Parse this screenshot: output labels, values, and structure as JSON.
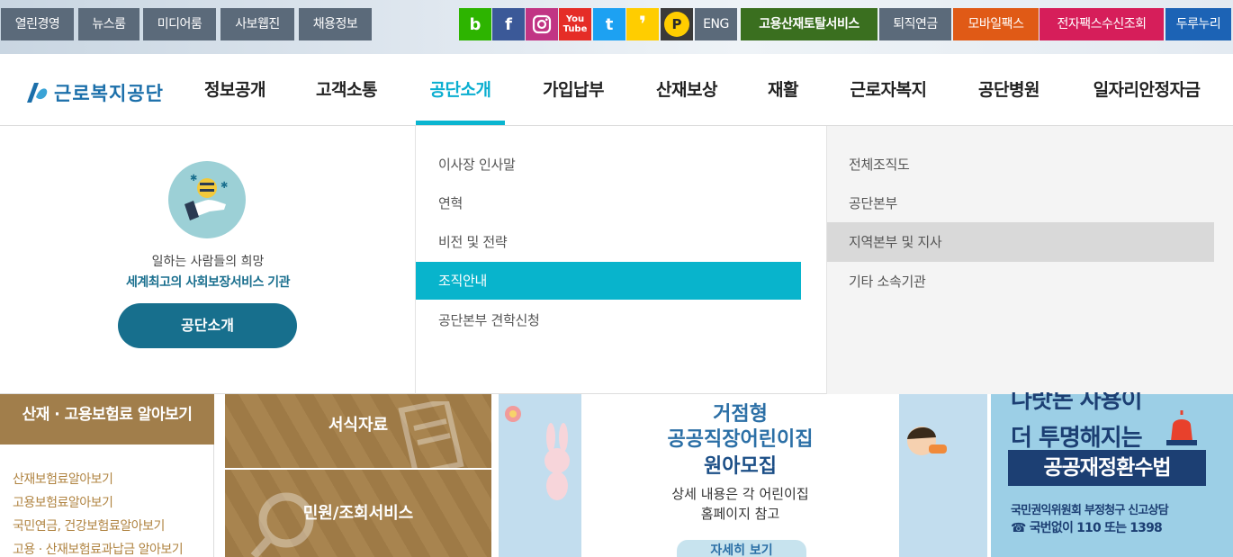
{
  "top_utility": [
    "열린경영",
    "뉴스룸",
    "미디어룸",
    "사보웹진",
    "채용정보"
  ],
  "sns": [
    {
      "icon": "blog-icon",
      "glyph": "b",
      "color": "#2db400"
    },
    {
      "icon": "facebook-icon",
      "glyph": "f",
      "color": "#3b5998"
    },
    {
      "icon": "instagram-icon",
      "glyph": "◎",
      "color": "#c13584"
    },
    {
      "icon": "youtube-icon",
      "glyph": "You",
      "color": "#e52d27"
    },
    {
      "icon": "twitter-icon",
      "glyph": "t",
      "color": "#1da1f2"
    },
    {
      "icon": "kakao-story-icon",
      "glyph": "❟",
      "color": "#ffcd00"
    },
    {
      "icon": "post-icon",
      "glyph": "P",
      "color": "#2a2a2a"
    }
  ],
  "right_links": [
    {
      "label": "ENG",
      "color": "#5b6a7a"
    },
    {
      "label": "고용산재토탈서비스",
      "color": "#3a6f1f"
    },
    {
      "label": "퇴직연금",
      "color": "#5b6a7a"
    },
    {
      "label": "모바일팩스",
      "color": "#e05a16"
    },
    {
      "label": "전자팩스수신조회",
      "color": "#d61e5a"
    },
    {
      "label": "두루누리",
      "color": "#1c63b5"
    }
  ],
  "logo": {
    "text": "근로복지공단"
  },
  "gnb": [
    "정보공개",
    "고객소통",
    "공단소개",
    "가입납부",
    "산재보상",
    "재활",
    "근로자복지",
    "공단병원",
    "일자리안정자금"
  ],
  "gnb_active": "공단소개",
  "dropdown": {
    "intro_sub": "일하는 사람들의 희망",
    "intro_main": "세계최고의 사회보장서비스 기관",
    "intro_button": "공단소개",
    "submenu": [
      "이사장 인사말",
      "연혁",
      "비전 및 전략",
      "조직안내",
      "공단본부 견학신청"
    ],
    "submenu_active": "조직안내",
    "third": [
      "전체조직도",
      "공단본부",
      "지역본부 및 지사",
      "기타 소속기관"
    ],
    "third_active": "지역본부 및 지사"
  },
  "insurance": {
    "title": "산재 · 고용보험료 알아보기",
    "links": [
      "산재보험료알아보기",
      "고용보험료알아보기",
      "국민연금, 건강보험료알아보기",
      "고용 · 산재보험료과납금 알아보기"
    ]
  },
  "tiles": [
    "서식자료",
    "민원/조회서비스"
  ],
  "banner1": {
    "title_lines": [
      "거점형",
      "공공직장어린이집",
      "원아모집"
    ],
    "desc_lines": [
      "상세 내용은 각 어린이집",
      "홈페이지 참고"
    ],
    "button": "자세히 보기"
  },
  "banner2": {
    "lines": [
      "나랏돈 사용이",
      "더 투명해지는"
    ],
    "box": "공공재정환수법",
    "small1": "국민권익위원회 부정청구 신고상담",
    "small2": "☎ 국번없이 110 또는 1398"
  }
}
